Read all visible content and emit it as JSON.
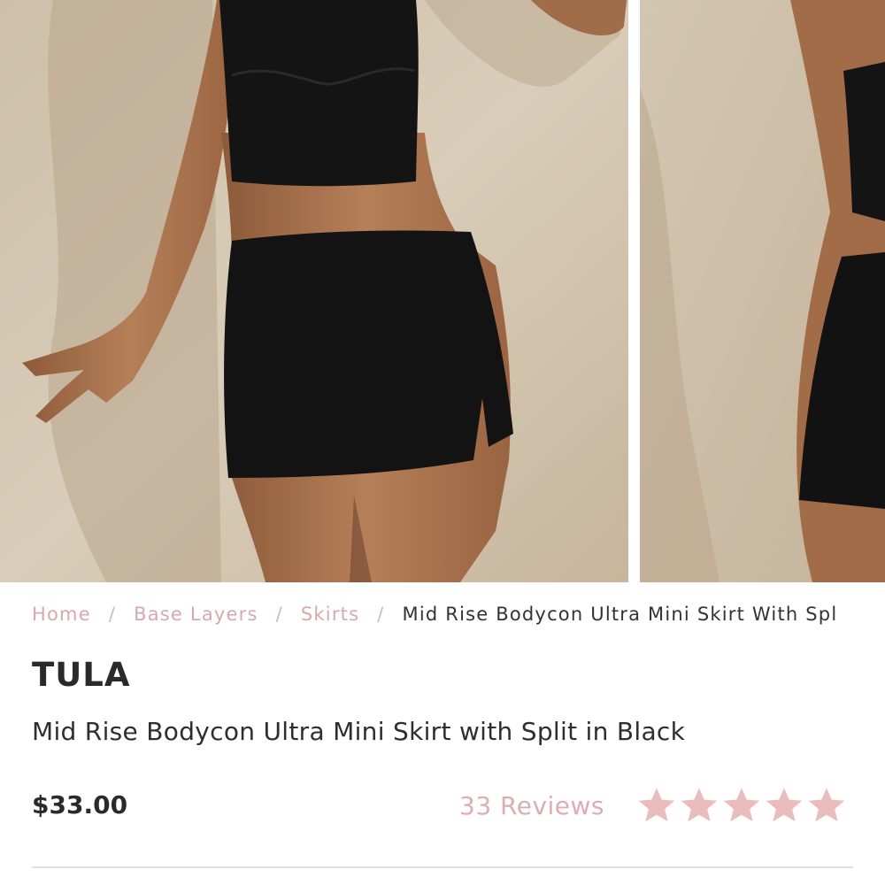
{
  "gallery": {
    "images": [
      {
        "name": "product-photo-front"
      },
      {
        "name": "product-photo-side"
      }
    ]
  },
  "breadcrumb": {
    "items": [
      {
        "label": "Home"
      },
      {
        "label": "Base Layers"
      },
      {
        "label": "Skirts"
      }
    ],
    "separator": "/",
    "current": "Mid Rise Bodycon Ultra Mini Skirt With Spl"
  },
  "product": {
    "brand": "TULA",
    "title": "Mid Rise Bodycon Ultra Mini Skirt with Split in Black",
    "price": "$33.00",
    "reviews_label": "33 Reviews",
    "rating": 5,
    "rating_max": 5
  },
  "colors": {
    "accent": "#dcaeb1",
    "star": "#ebbcbc",
    "text": "#2b2b2b",
    "divider": "#e3e3e3"
  }
}
